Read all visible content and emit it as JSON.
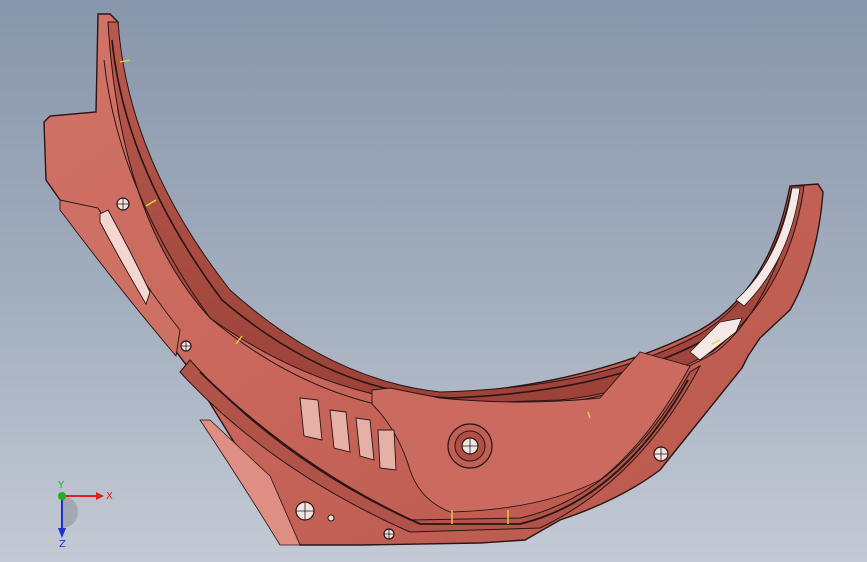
{
  "viewport": {
    "background_top": "#8896ab",
    "background_bottom": "#c3cad5",
    "part_color": "#c8665b",
    "part_shadow": "#a4483f",
    "edge_color": "#2a1414",
    "highlight_color": "#e9b8ae",
    "marker_color": "#e8d23a"
  },
  "triad": {
    "x_label": "X",
    "y_label": "Y",
    "z_label": "Z",
    "x_color": "#e02020",
    "y_color": "#20b020",
    "z_color": "#2030d0"
  }
}
